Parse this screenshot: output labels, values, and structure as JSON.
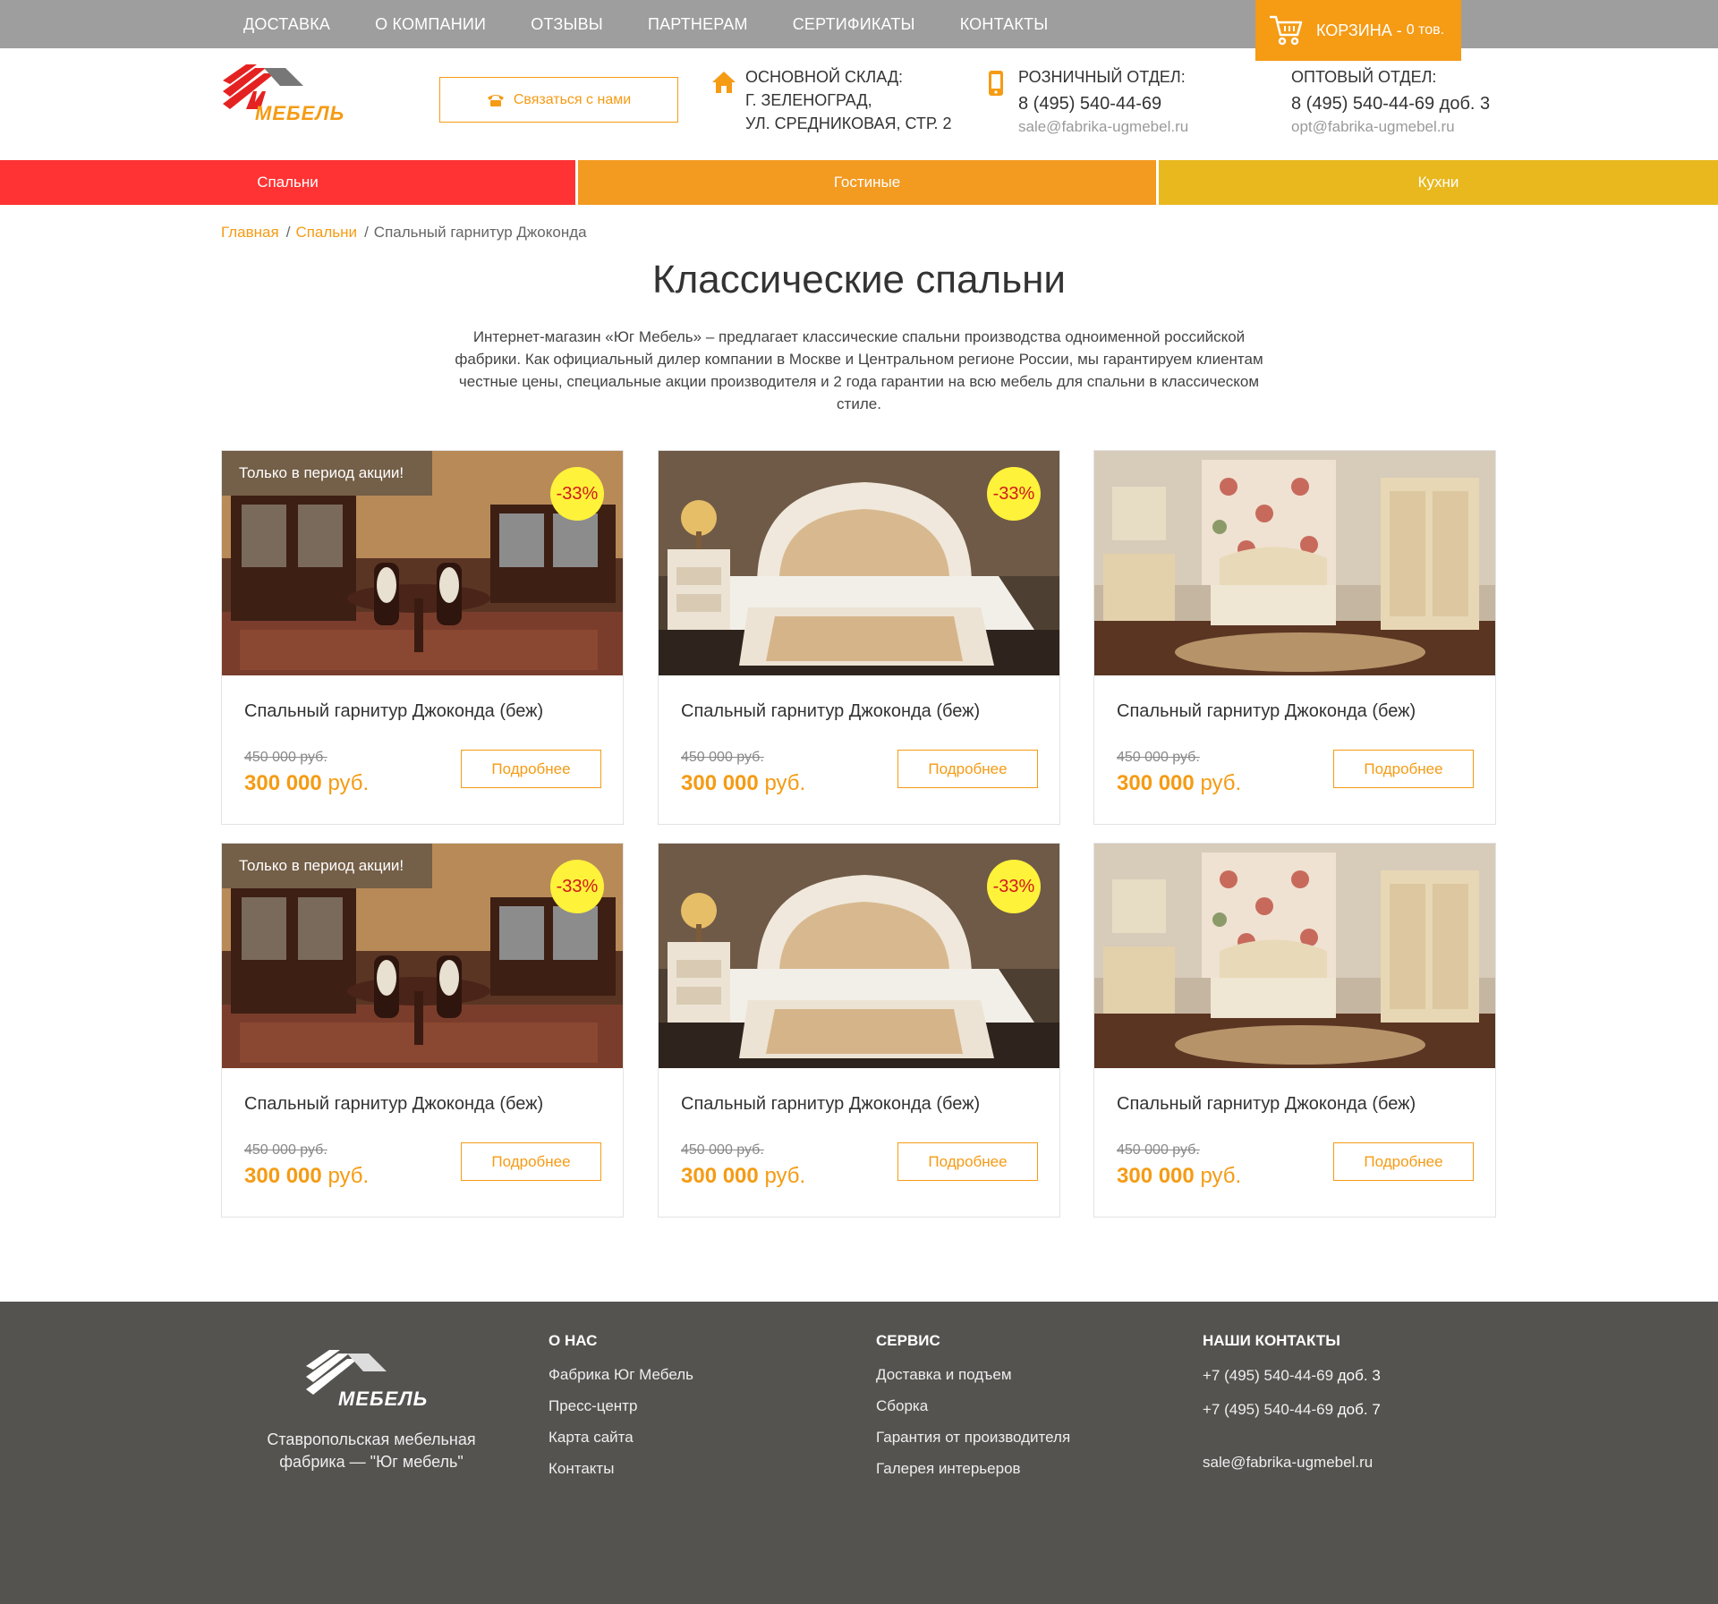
{
  "topnav": [
    "ДОСТАВКА",
    "О КОМПАНИИ",
    "ОТЗЫВЫ",
    "ПАРТНЕРАМ",
    "СЕРТИФИКАТЫ",
    "КОНТАКТЫ"
  ],
  "cart": {
    "label": "КОРЗИНА - ",
    "count": "0 тов."
  },
  "header": {
    "logo_text": "МЕБЕЛЬ",
    "contact_button": "Связаться с нами",
    "warehouse": {
      "label": "ОСНОВНОЙ СКЛАД:",
      "line1": "Г. ЗЕЛЕНОГРАД,",
      "line2": "УЛ. СРЕДНИКОВАЯ, СТР. 2"
    },
    "retail": {
      "label": "РОЗНИЧНЫЙ ОТДЕЛ:",
      "phone": "8 (495) 540-44-69",
      "email": "sale@fabrika-ugmebel.ru"
    },
    "wholesale": {
      "label": "ОПТОВЫЙ ОТДЕЛ:",
      "phone": "8 (495) 540-44-69 доб. 3",
      "email": "opt@fabrika-ugmebel.ru"
    }
  },
  "categories": [
    {
      "label": "Спальни",
      "color": "#ff3333"
    },
    {
      "label": "Гостиные",
      "color": "#f39a21"
    },
    {
      "label": "Кухни",
      "color": "#e8b81e"
    }
  ],
  "breadcrumbs": {
    "home": "Главная",
    "section": "Спальни",
    "current": "Спальный гарнитур Джоконда"
  },
  "page_title": "Классические спальни",
  "intro": "Интернет-магазин «Юг Мебель» – предлагает классические спальни производства одноименной российской фабрики. Как официальный дилер компании в Москве и Центральном регионе России, мы гарантируем клиентам честные цены, специальные акции производителя и 2 года гарантии на всю мебель для спальни в классическом стиле.",
  "products": [
    {
      "title": "Спальный гарнитур Джоконда (беж)",
      "old_price": "450 000 руб.",
      "price_num": "300 000",
      "price_unit": "руб.",
      "button": "Подробнее",
      "promo": "Только в период акции!",
      "discount": "-33%",
      "image": "dining-room"
    },
    {
      "title": "Спальный гарнитур Джоконда (беж)",
      "old_price": "450 000 руб.",
      "price_num": "300 000",
      "price_unit": "руб.",
      "button": "Подробнее",
      "promo": "",
      "discount": "-33%",
      "image": "white-bed"
    },
    {
      "title": "Спальный гарнитур Джоконда (беж)",
      "old_price": "450 000 руб.",
      "price_num": "300 000",
      "price_unit": "руб.",
      "button": "Подробнее",
      "promo": "",
      "discount": "",
      "image": "floral-bedroom"
    },
    {
      "title": "Спальный гарнитур Джоконда (беж)",
      "old_price": "450 000 руб.",
      "price_num": "300 000",
      "price_unit": "руб.",
      "button": "Подробнее",
      "promo": "Только в период акции!",
      "discount": "-33%",
      "image": "dining-room"
    },
    {
      "title": "Спальный гарнитур Джоконда (беж)",
      "old_price": "450 000 руб.",
      "price_num": "300 000",
      "price_unit": "руб.",
      "button": "Подробнее",
      "promo": "",
      "discount": "-33%",
      "image": "white-bed"
    },
    {
      "title": "Спальный гарнитур Джоконда (беж)",
      "old_price": "450 000 руб.",
      "price_num": "300 000",
      "price_unit": "руб.",
      "button": "Подробнее",
      "promo": "",
      "discount": "",
      "image": "floral-bedroom"
    }
  ],
  "footer": {
    "description": "Ставропольская мебельная фабрика — \"Юг мебель\"",
    "about": {
      "heading": "О НАС",
      "links": [
        "Фабрика Юг Мебель",
        "Пресс-центр",
        "Карта сайта",
        "Контакты"
      ]
    },
    "service": {
      "heading": "СЕРВИС",
      "links": [
        "Доставка и подъем",
        "Сборка",
        "Гарантия от производителя",
        "Галерея интерьеров"
      ]
    },
    "contacts": {
      "heading": "НАШИ КОНТАКТЫ",
      "phone1": "+7 (495) 540-44-69",
      "ext1": "доб. 3",
      "phone2": "+7 (495) 540-44-69",
      "ext2": "доб. 7",
      "email": "sale@fabrika-ugmebel.ru"
    }
  },
  "colors": {
    "accent": "#f59b14",
    "topbar": "#9e9e9e",
    "footer": "#545350",
    "discount_badge": "#fff23a"
  }
}
